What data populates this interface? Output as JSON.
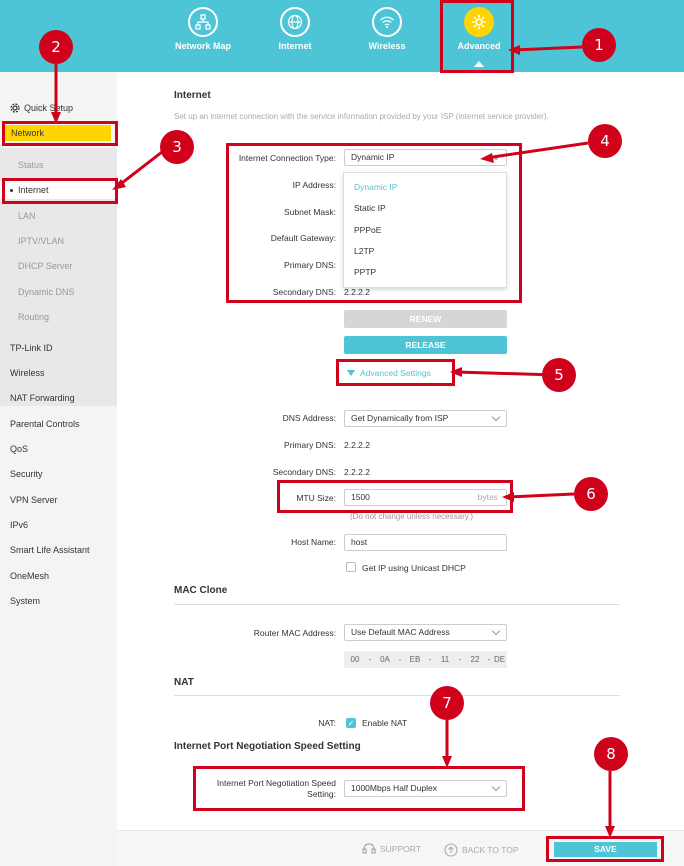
{
  "topnav": [
    {
      "label": "Network Map",
      "icon": "network-map-icon"
    },
    {
      "label": "Internet",
      "icon": "globe-icon"
    },
    {
      "label": "Wireless",
      "icon": "wifi-icon"
    },
    {
      "label": "Advanced",
      "icon": "gear-icon",
      "active": true
    }
  ],
  "sidebar": {
    "quick_setup": "Quick Setup",
    "network": "Network",
    "sub": [
      "Status",
      "Internet",
      "LAN",
      "IPTV/VLAN",
      "DHCP Server",
      "Dynamic DNS",
      "Routing"
    ],
    "items": [
      "TP-Link ID",
      "Wireless",
      "NAT Forwarding",
      "Parental Controls",
      "QoS",
      "Security",
      "VPN Server",
      "IPv6",
      "Smart Life Assistant",
      "OneMesh",
      "System"
    ]
  },
  "internet": {
    "title": "Internet",
    "hint": "Set up an internet connection with the service information provided by your ISP (internet service provider).",
    "conn_type_label": "Internet Connection Type:",
    "conn_type_value": "Dynamic IP",
    "ip_label": "IP Address:",
    "subnet_label": "Subnet Mask:",
    "gateway_label": "Default Gateway:",
    "pdns_label": "Primary DNS:",
    "sdns_label": "Secondary DNS:",
    "sdns_value": "2.2.2.2",
    "dropdown_options": [
      "Dynamic IP",
      "Static IP",
      "PPPoE",
      "L2TP",
      "PPTP"
    ],
    "renew": "RENEW",
    "release": "RELEASE",
    "advanced_settings": "Advanced Settings",
    "dns_address_label": "DNS Address:",
    "dns_address_value": "Get Dynamically from ISP",
    "adv_pdns_label": "Primary DNS:",
    "adv_pdns_value": "2.2.2.2",
    "adv_sdns_label": "Secondary DNS:",
    "adv_sdns_value": "2.2.2.2",
    "mtu_label": "MTU Size:",
    "mtu_value": "1500",
    "mtu_unit": "bytes",
    "mtu_hint": "(Do not change unless necessary.)",
    "host_label": "Host Name:",
    "host_value": "host",
    "unicast": "Get IP using Unicast DHCP"
  },
  "mac_clone": {
    "title": "MAC Clone",
    "label": "Router MAC Address:",
    "value": "Use Default MAC Address",
    "mac": [
      "00",
      "0A",
      "EB",
      "11",
      "22",
      "DE"
    ],
    "sep": "-"
  },
  "nat": {
    "title": "NAT",
    "label": "NAT:",
    "value": "Enable NAT"
  },
  "speed": {
    "title": "Internet Port Negotiation Speed Setting",
    "label1": "Internet Port Negotiation Speed",
    "label2": "Setting:",
    "value": "1000Mbps Half Duplex"
  },
  "footer": {
    "support": "SUPPORT",
    "back_to_top": "BACK TO TOP",
    "save": "SAVE"
  },
  "callouts": [
    "1",
    "2",
    "3",
    "4",
    "5",
    "6",
    "7",
    "8"
  ],
  "colors": {
    "accent": "#4ec5d6",
    "highlight": "#ffd400",
    "annotation": "#d0021b"
  }
}
